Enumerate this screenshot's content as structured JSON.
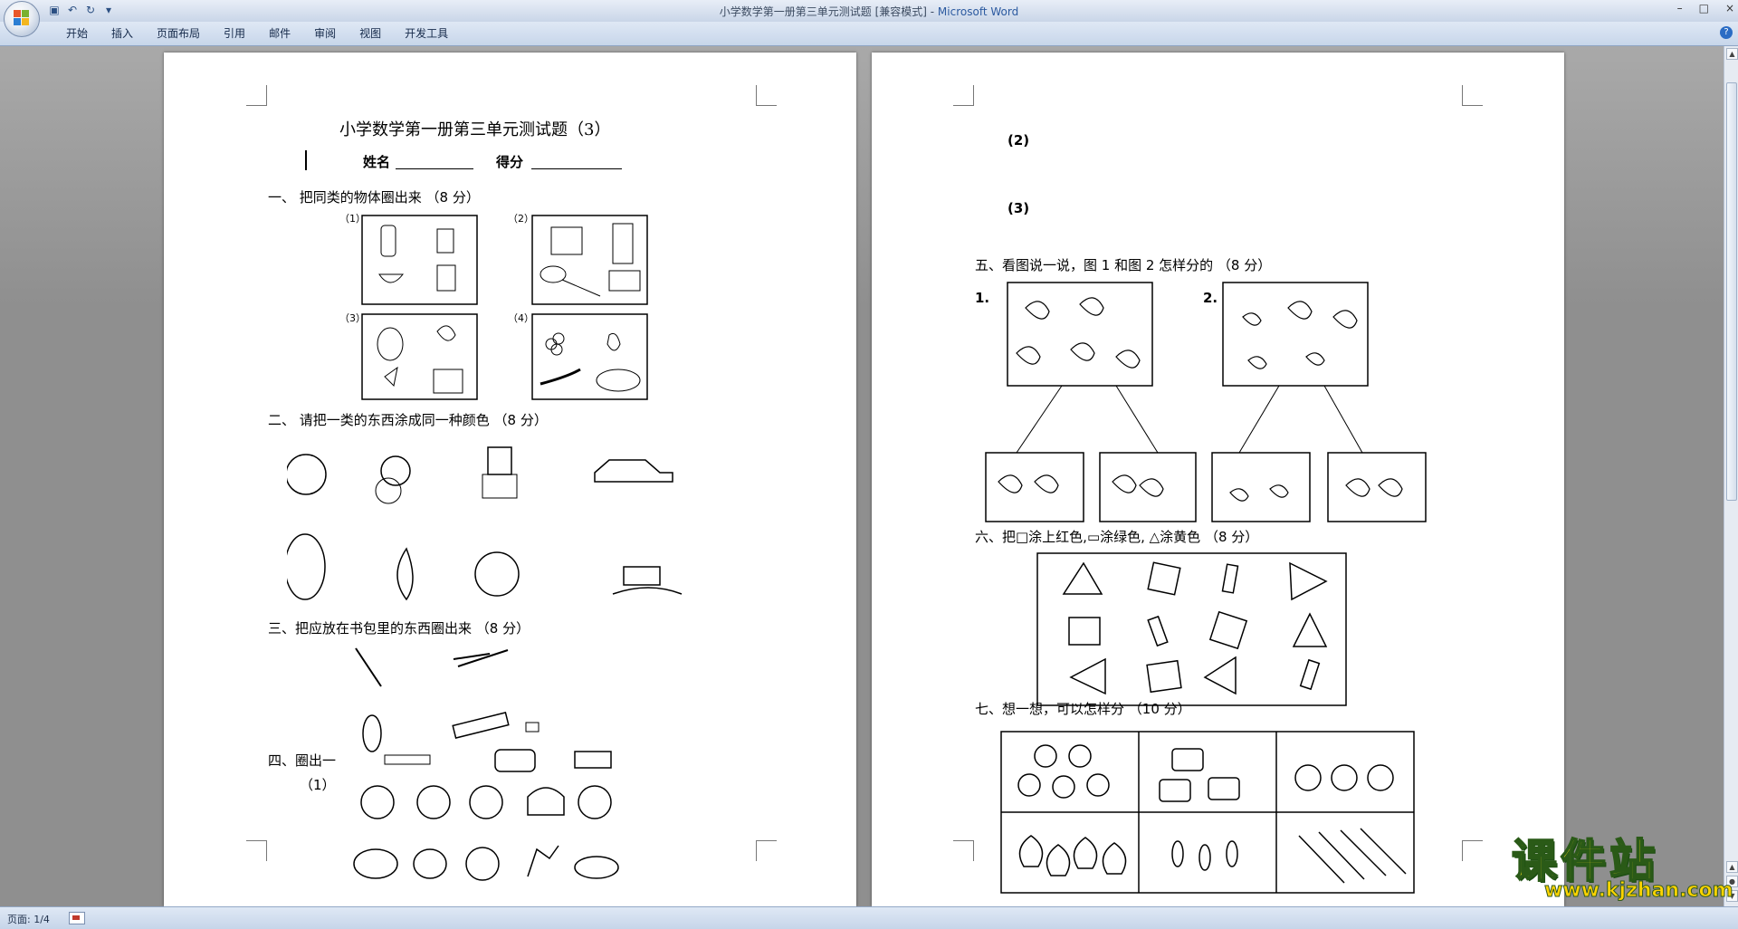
{
  "window": {
    "title": "小学数学第一册第三单元测试题 [兼容模式] - ",
    "app_name": "Microsoft Word",
    "controls": [
      "–",
      "□",
      "×"
    ]
  },
  "quick_access": {
    "icons": [
      "save-icon",
      "undo-icon",
      "redo-icon",
      "customize-icon"
    ]
  },
  "ribbon": {
    "tabs": [
      "开始",
      "插入",
      "页面布局",
      "引用",
      "邮件",
      "审阅",
      "视图",
      "开发工具"
    ]
  },
  "status": {
    "page": "页面: 1/4"
  },
  "page1": {
    "title": "小学数学第一册第三单元测试题（3）",
    "name_label": "姓名",
    "score_label": "得分",
    "q1": "一、  把同类的物体圈出来 （8 分）",
    "q1_labels": [
      "（1）",
      "（2）",
      "（3）",
      "（4）"
    ],
    "q2": "二、  请把一类的东西涂成同一种颜色 （8 分）",
    "q3": "三、把应放在书包里的东西圈出来 （8 分）",
    "q4": "四、圈出一",
    "q4_sub": "（1）"
  },
  "page2": {
    "item2": "(2)",
    "item3": "(3)",
    "q5": "五、看图说一说，图 1 和图 2 怎样分的 （8 分）",
    "q5_labels": [
      "1.",
      "2."
    ],
    "q6": "六、把□涂上红色,▭涂绿色, △涂黄色 （8 分）",
    "q7": "七、想一想，可以怎样分 （10 分）"
  },
  "watermark": {
    "text": "课件站",
    "url": "www.kjzhan.com"
  }
}
